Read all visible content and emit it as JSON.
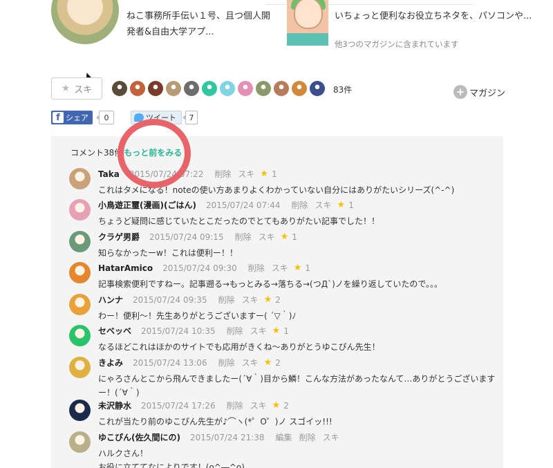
{
  "top_left": {
    "text": "ねこ事務所手伝い１号、且つ個人開発者&自由大学アプ..."
  },
  "top_right": {
    "text": "いちょっと便利なお役立ちネタを、パソコンや...",
    "sub": "他3つのマガジンに含まれています"
  },
  "like": {
    "label": "スキ",
    "count": "83件"
  },
  "likers": [
    "#5a4a3a",
    "#c4623a",
    "#7a3b2a",
    "#b89a74",
    "#6d6d6d",
    "#2fc7a0",
    "#7fd4e6",
    "#e68fb5",
    "#8a9a6a",
    "#b77d5a",
    "#d28a3a",
    "#3b4f8a"
  ],
  "magazine": {
    "label": "マガジン"
  },
  "share": {
    "label": "シェア",
    "count": "0",
    "tweet_label": "ツイート",
    "tweet_count": "7"
  },
  "comments_header": {
    "count_label": "コメント38件",
    "more": "もっと前をみる"
  },
  "comments": [
    {
      "name": "Taka",
      "date": "2015/07/24 07:22",
      "delete": "削除",
      "like": "スキ",
      "likes": "1",
      "body": "これはタメになる！noteの使い方あまりよくわかっていない自分にはありがたいシリーズ(^-^)",
      "color": "#c9a27a"
    },
    {
      "name": "小鳥遊正璽(漫画)(ごはん)",
      "date": "2015/07/24 07:44",
      "delete": "削除",
      "like": "スキ",
      "likes": "1",
      "body": "ちょうど疑問に感じていたとこだったのでとてもありがたい記事でした！！",
      "color": "#e8a0b4"
    },
    {
      "name": "クラゲ男爵",
      "date": "2015/07/24 09:15",
      "delete": "削除",
      "like": "スキ",
      "likes": "1",
      "body": "知らなかったーw！これは便利ー！！",
      "color": "#6a9a7a"
    },
    {
      "name": "HatarAmico",
      "date": "2015/07/24 09:30",
      "delete": "削除",
      "like": "スキ",
      "likes": "1",
      "body": "記事検索便利ですねー。記事遡る→もっとみる→落ちる→(つД`)ノを繰り返していたので。。。",
      "color": "#e5872c"
    },
    {
      "name": "ハンナ",
      "date": "2015/07/24 09:35",
      "delete": "削除",
      "like": "スキ",
      "likes": "2",
      "body": "わー！便利〜！先生ありがとうございますー( ´▽｀)ﾉ",
      "color": "#e9a23a"
    },
    {
      "name": "セベッベ",
      "date": "2015/07/24 10:35",
      "delete": "削除",
      "like": "スキ",
      "likes": "1",
      "body": "なるほどこれはほかのサイトでも応用がきくね〜ありがとうゆこぴん先生！",
      "color": "#29c46a"
    },
    {
      "name": "きよみ",
      "date": "2015/07/24 13:06",
      "delete": "削除",
      "like": "スキ",
      "likes": "2",
      "body": "にゃろさんとこから飛んできましたー(´∀｀)目から鱗！こんな方法があったなんて…ありがとうございますー！(´∀｀)",
      "color": "#e0b040"
    },
    {
      "name": "未沢静水",
      "date": "2015/07/24 17:26",
      "delete": "削除",
      "like": "スキ",
      "likes": "2",
      "body": "これが当たり前のゆこぴん先生が♪⌒ヽ(*゜O゜)ノ スゴイッ!!!",
      "color": "#1b2a4a"
    },
    {
      "name": "ゆこぴん(佐久間にの)",
      "date": "2015/07/24 21:38",
      "edit": "編集",
      "delete": "削除",
      "like": "スキ",
      "likes": "",
      "body": "ハルクさん！\nお役に立ててなによりです！(o^―^o)",
      "color": "#b8b08a"
    }
  ]
}
